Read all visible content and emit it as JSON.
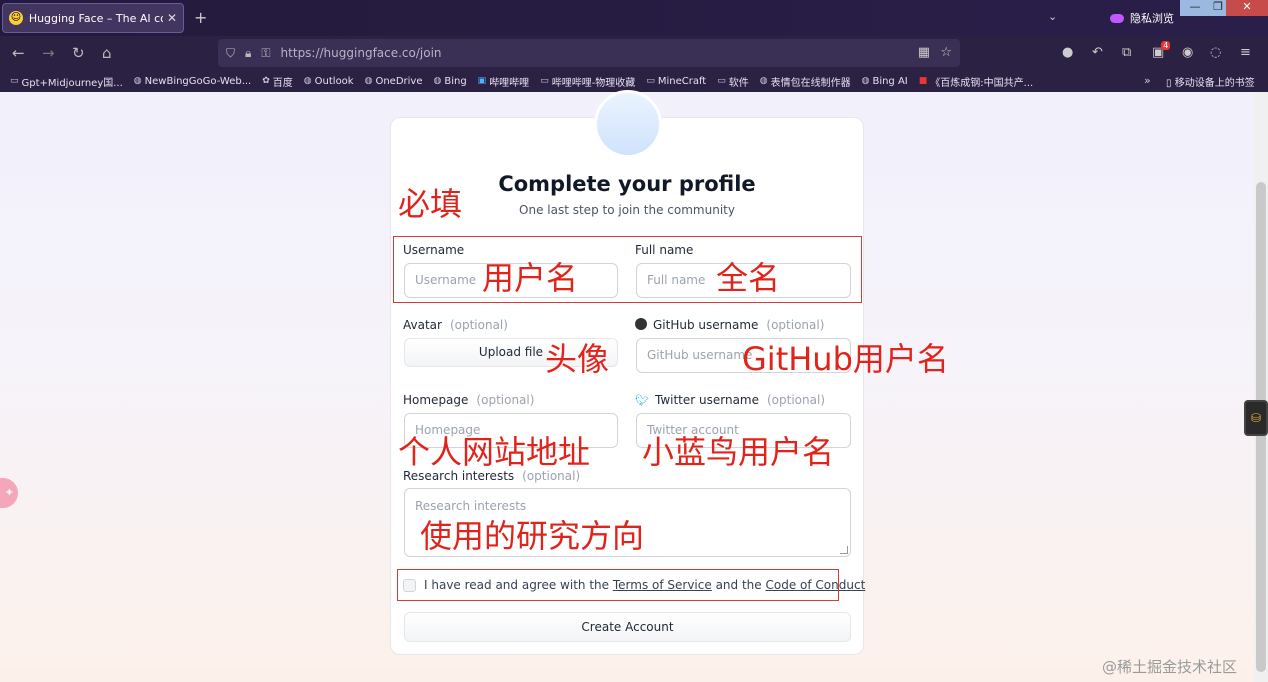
{
  "browser": {
    "tab_title": "Hugging Face – The AI comm",
    "tab_close": "✕",
    "new_tab": "+",
    "tabs_list": "⌄",
    "private_label": "隐私浏览",
    "win_min": "—",
    "win_max": "❐",
    "win_close": "✕",
    "url": "https://huggingface.co/join",
    "bookmarks": [
      "Gpt+Midjourney国...",
      "NewBingGoGo-Web...",
      "百度",
      "Outlook",
      "OneDrive",
      "Bing",
      "哔哩哔哩",
      "哔哩哔哩-物理收藏",
      "MineCraft",
      "软件",
      "表情包在线制作器",
      "Bing AI",
      "《百炼成钢:中国共产..."
    ],
    "bookmarks_more": "»",
    "mobile_bookmarks": "移动设备上的书签",
    "extension_badge": "4"
  },
  "form": {
    "title": "Complete your profile",
    "subtitle": "One last step to join the community",
    "username_label": "Username",
    "username_placeholder": "Username",
    "fullname_label": "Full name",
    "fullname_placeholder": "Full name",
    "avatar_label": "Avatar",
    "optional": "(optional)",
    "upload_label": "Upload file",
    "github_label": "GitHub username",
    "github_placeholder": "GitHub username",
    "homepage_label": "Homepage",
    "homepage_placeholder": "Homepage",
    "twitter_label": "Twitter username",
    "twitter_placeholder": "Twitter account",
    "research_label": "Research interests",
    "research_placeholder": "Research interests",
    "agree_prefix": "I have read and agree with the ",
    "terms_link": "Terms of Service",
    "agree_mid": " and the ",
    "conduct_link": "Code of Conduct",
    "create_button": "Create Account"
  },
  "annotations": {
    "required": "必填",
    "username": "用户名",
    "fullname": "全名",
    "avatar": "头像",
    "github": "GitHub用户名",
    "homepage": "个人网站地址",
    "twitter": "小蓝鸟用户名",
    "research": "使用的研究方向"
  },
  "watermark": "@稀土掘金技术社区",
  "colors": {
    "annotation": "#e0241b",
    "chrome": "#2b2142"
  }
}
